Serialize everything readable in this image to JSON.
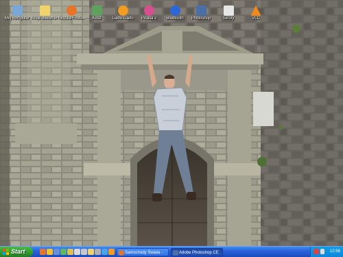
{
  "desktop": {
    "icons": [
      {
        "label": "Mój komputer",
        "icon": "my-computer-icon",
        "color": "#7aa6d8"
      },
      {
        "label": "Moje dokumenty",
        "icon": "folder-icon",
        "color": "#f2d36b"
      },
      {
        "label": "Mozilla Firefox",
        "icon": "firefox-icon",
        "color": "#e8742a"
      },
      {
        "label": "Kosz",
        "icon": "recycle-bin-icon",
        "color": "#5fa05f"
      },
      {
        "label": "Gadu-Gadu",
        "icon": "gadu-gadu-icon",
        "color": "#f29c21"
      },
      {
        "label": "Picasa 2",
        "icon": "picasa-icon",
        "color": "#d84f8f"
      },
      {
        "label": "Bluetooth",
        "icon": "bluetooth-icon",
        "color": "#2d67d6"
      },
      {
        "label": "Photoshop",
        "icon": "photoshop-icon",
        "color": "#4a6fa6"
      },
      {
        "label": "Skróty",
        "icon": "shortcut-icon",
        "color": "#e6e6e6"
      },
      {
        "label": "VLC",
        "icon": "vlc-icon",
        "color": "#f28a1a"
      }
    ]
  },
  "taskbar": {
    "start_label": "Start",
    "quick_launch": [
      {
        "icon": "firefox-quicklaunch-icon",
        "color": "#e8742a"
      },
      {
        "icon": "media-player-quicklaunch-icon",
        "color": "#f0c030"
      },
      {
        "icon": "show-desktop-quicklaunch-icon",
        "color": "#6a8ed8"
      },
      {
        "icon": "messenger-quicklaunch-icon",
        "color": "#5fb85f"
      },
      {
        "icon": "explorer-quicklaunch-icon",
        "color": "#e0c050"
      },
      {
        "icon": "outlook-quicklaunch-icon",
        "color": "#d9d9d9"
      },
      {
        "icon": "notepad-quicklaunch-icon",
        "color": "#c8c8c8"
      },
      {
        "icon": "folder-quicklaunch-icon",
        "color": "#f2d36b"
      },
      {
        "icon": "winamp-quicklaunch-icon",
        "color": "#b0b0b0"
      },
      {
        "icon": "skype-quicklaunch-icon",
        "color": "#4aa4e8"
      },
      {
        "icon": "gadu-quicklaunch-icon",
        "color": "#f29c21"
      }
    ],
    "tasks": [
      {
        "label": "Samochody Świata -",
        "icon": "firefox-task-icon",
        "color": "#e8742a"
      },
      {
        "label": "Adobe Photoshop CE",
        "icon": "photoshop-task-icon",
        "color": "#4a6fa6"
      }
    ],
    "clock": "12:56"
  }
}
